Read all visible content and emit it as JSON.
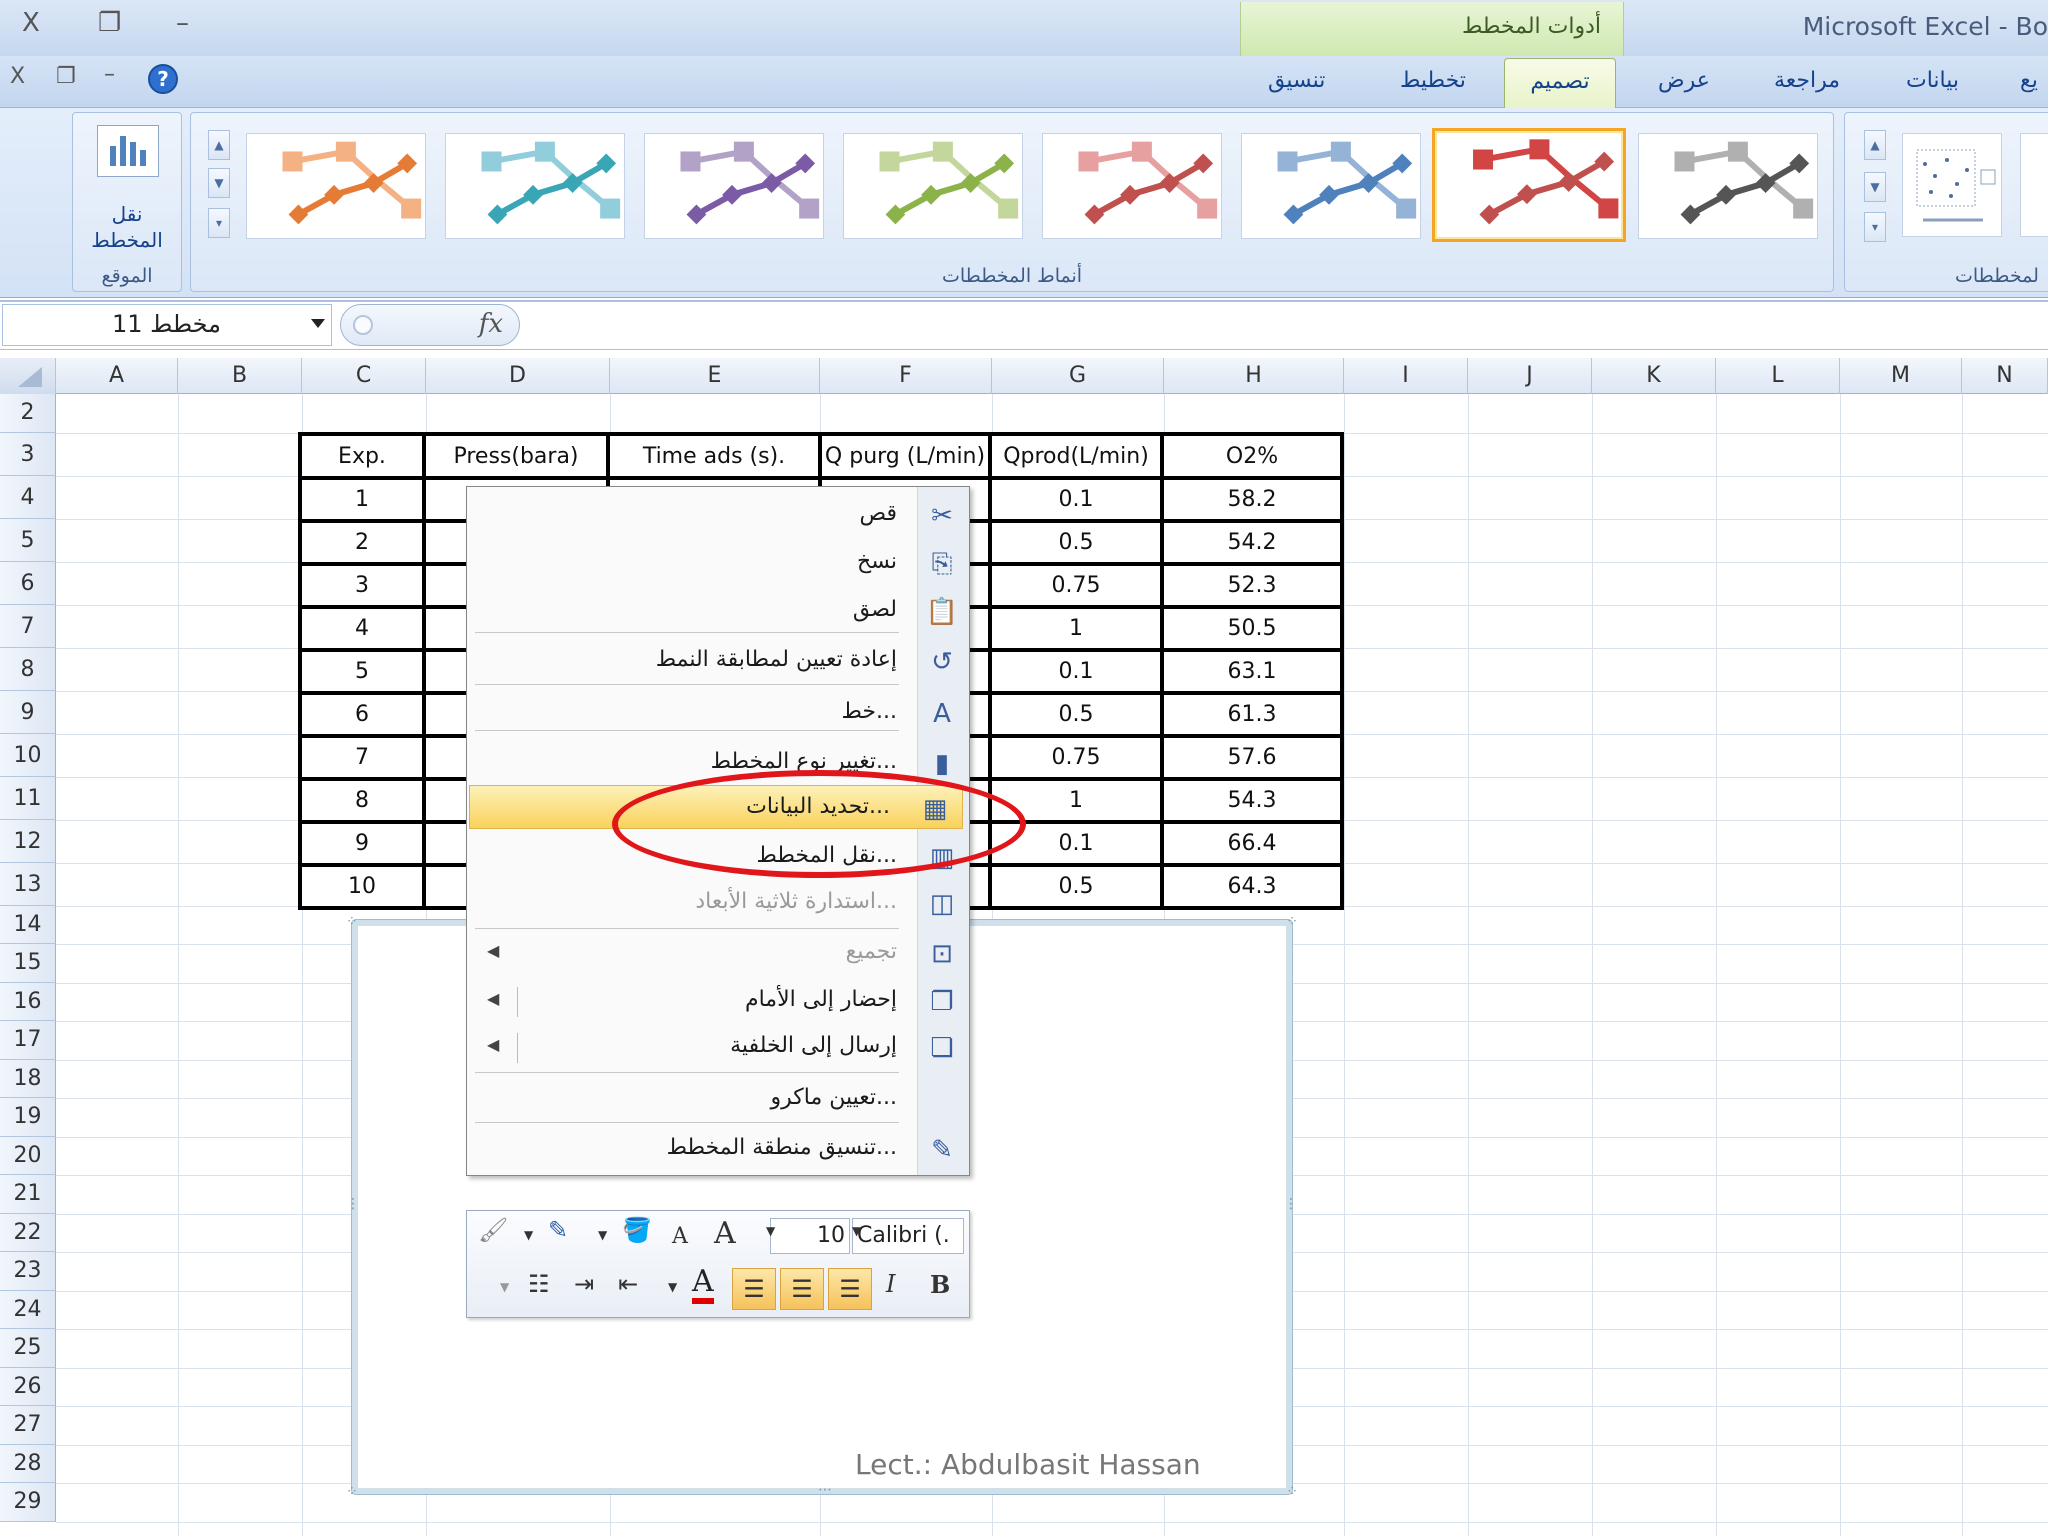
{
  "window": {
    "app_title": "Microsoft Excel - Bo",
    "contextual_tools": "أدوات المخطط",
    "controls": {
      "close": "X",
      "restore": "❐",
      "minimize": "–"
    }
  },
  "ribbon": {
    "tabs": [
      "تنسيق",
      "تخطيط",
      "تصميم",
      "عرض",
      "مراجعة",
      "بيانات",
      "يع"
    ],
    "active_tab": "تصميم",
    "groups": {
      "location": {
        "label": "الموقع",
        "button": "نقل المخطط"
      },
      "styles": {
        "label": "أنماط المخططات"
      },
      "layouts": {
        "label": "لمخططات"
      }
    },
    "style_colors": [
      "#e57b34",
      "#3aa6b5",
      "#7b5aa6",
      "#8bb34a",
      "#c0504d",
      "#4f81bd",
      "#c0504d",
      "#555555"
    ],
    "style_light_colors": [
      "#f4b183",
      "#92cddc",
      "#b3a2c7",
      "#c3d69b",
      "#e6a0a0",
      "#95b3d7",
      "#d24545",
      "#b0b0b0"
    ],
    "selected_style_index": 6
  },
  "formula_bar": {
    "name_box": "مخطط 11",
    "fx": "fx"
  },
  "grid": {
    "columns": [
      "A",
      "B",
      "C",
      "D",
      "E",
      "F",
      "G",
      "H",
      "I",
      "J",
      "K",
      "L",
      "M",
      "N"
    ],
    "rows": [
      "2",
      "3",
      "4",
      "5",
      "6",
      "7",
      "8",
      "9",
      "10",
      "11",
      "12",
      "13",
      "14",
      "15",
      "16",
      "17",
      "18",
      "19",
      "20",
      "21",
      "22",
      "23",
      "24",
      "25",
      "26",
      "27",
      "28",
      "29"
    ]
  },
  "table": {
    "headers": [
      "Exp.",
      "Press(bara)",
      "Time ads (s).",
      "Q purg (L/min)",
      "Qprod(L/min)",
      "O2%"
    ],
    "rows": [
      [
        "1",
        "0.1",
        "58.2"
      ],
      [
        "2",
        "0.5",
        "54.2"
      ],
      [
        "3",
        "0.75",
        "52.3"
      ],
      [
        "4",
        "1",
        "50.5"
      ],
      [
        "5",
        "0.1",
        "63.1"
      ],
      [
        "6",
        "0.5",
        "61.3"
      ],
      [
        "7",
        "0.75",
        "57.6"
      ],
      [
        "8",
        "1",
        "54.3"
      ],
      [
        "9",
        "0.1",
        "66.4"
      ],
      [
        "10",
        "0.5",
        "64.3"
      ]
    ]
  },
  "context_menu": {
    "items": [
      {
        "label": "قص",
        "icon": "scissors-icon",
        "glyph": "✂"
      },
      {
        "label": "نسخ",
        "icon": "copy-icon",
        "glyph": "⎘"
      },
      {
        "label": "لصق",
        "icon": "paste-icon",
        "glyph": "📋"
      },
      {
        "label": "إعادة تعيين لمطابقة النمط",
        "icon": "reset-style-icon",
        "glyph": "↺"
      },
      {
        "label": "خط...",
        "icon": "font-icon",
        "glyph": "A"
      },
      {
        "label": "تغيير نوع المخطط...",
        "icon": "chart-type-icon",
        "glyph": "▮"
      },
      {
        "label": "تحديد البيانات...",
        "icon": "select-data-icon",
        "glyph": "▦"
      },
      {
        "label": "نقل المخطط...",
        "icon": "move-chart-icon",
        "glyph": "▥"
      },
      {
        "label": "استدارة ثلاثية الأبعاد...",
        "icon": "rotation-3d-icon",
        "glyph": "◫"
      },
      {
        "label": "تجميع",
        "icon": "group-icon",
        "glyph": "⊡"
      },
      {
        "label": "إحضار إلى الأمام",
        "icon": "bring-front-icon",
        "glyph": "❐"
      },
      {
        "label": "إرسال إلى الخلفية",
        "icon": "send-back-icon",
        "glyph": "❏"
      },
      {
        "label": "تعيين ماكرو...",
        "icon": "macro-icon",
        "glyph": ""
      },
      {
        "label": "تنسيق منطقة المخطط...",
        "icon": "format-chart-area-icon",
        "glyph": "✎"
      }
    ],
    "highlighted": "تحديد البيانات..."
  },
  "mini_toolbar": {
    "font": "Calibri (.",
    "size": "10",
    "bold": "B",
    "italic": "I",
    "font_color": "A",
    "grow": "A",
    "shrink": "A"
  },
  "chart": {
    "credit": "Lect.: Abdulbasit Hassan"
  }
}
